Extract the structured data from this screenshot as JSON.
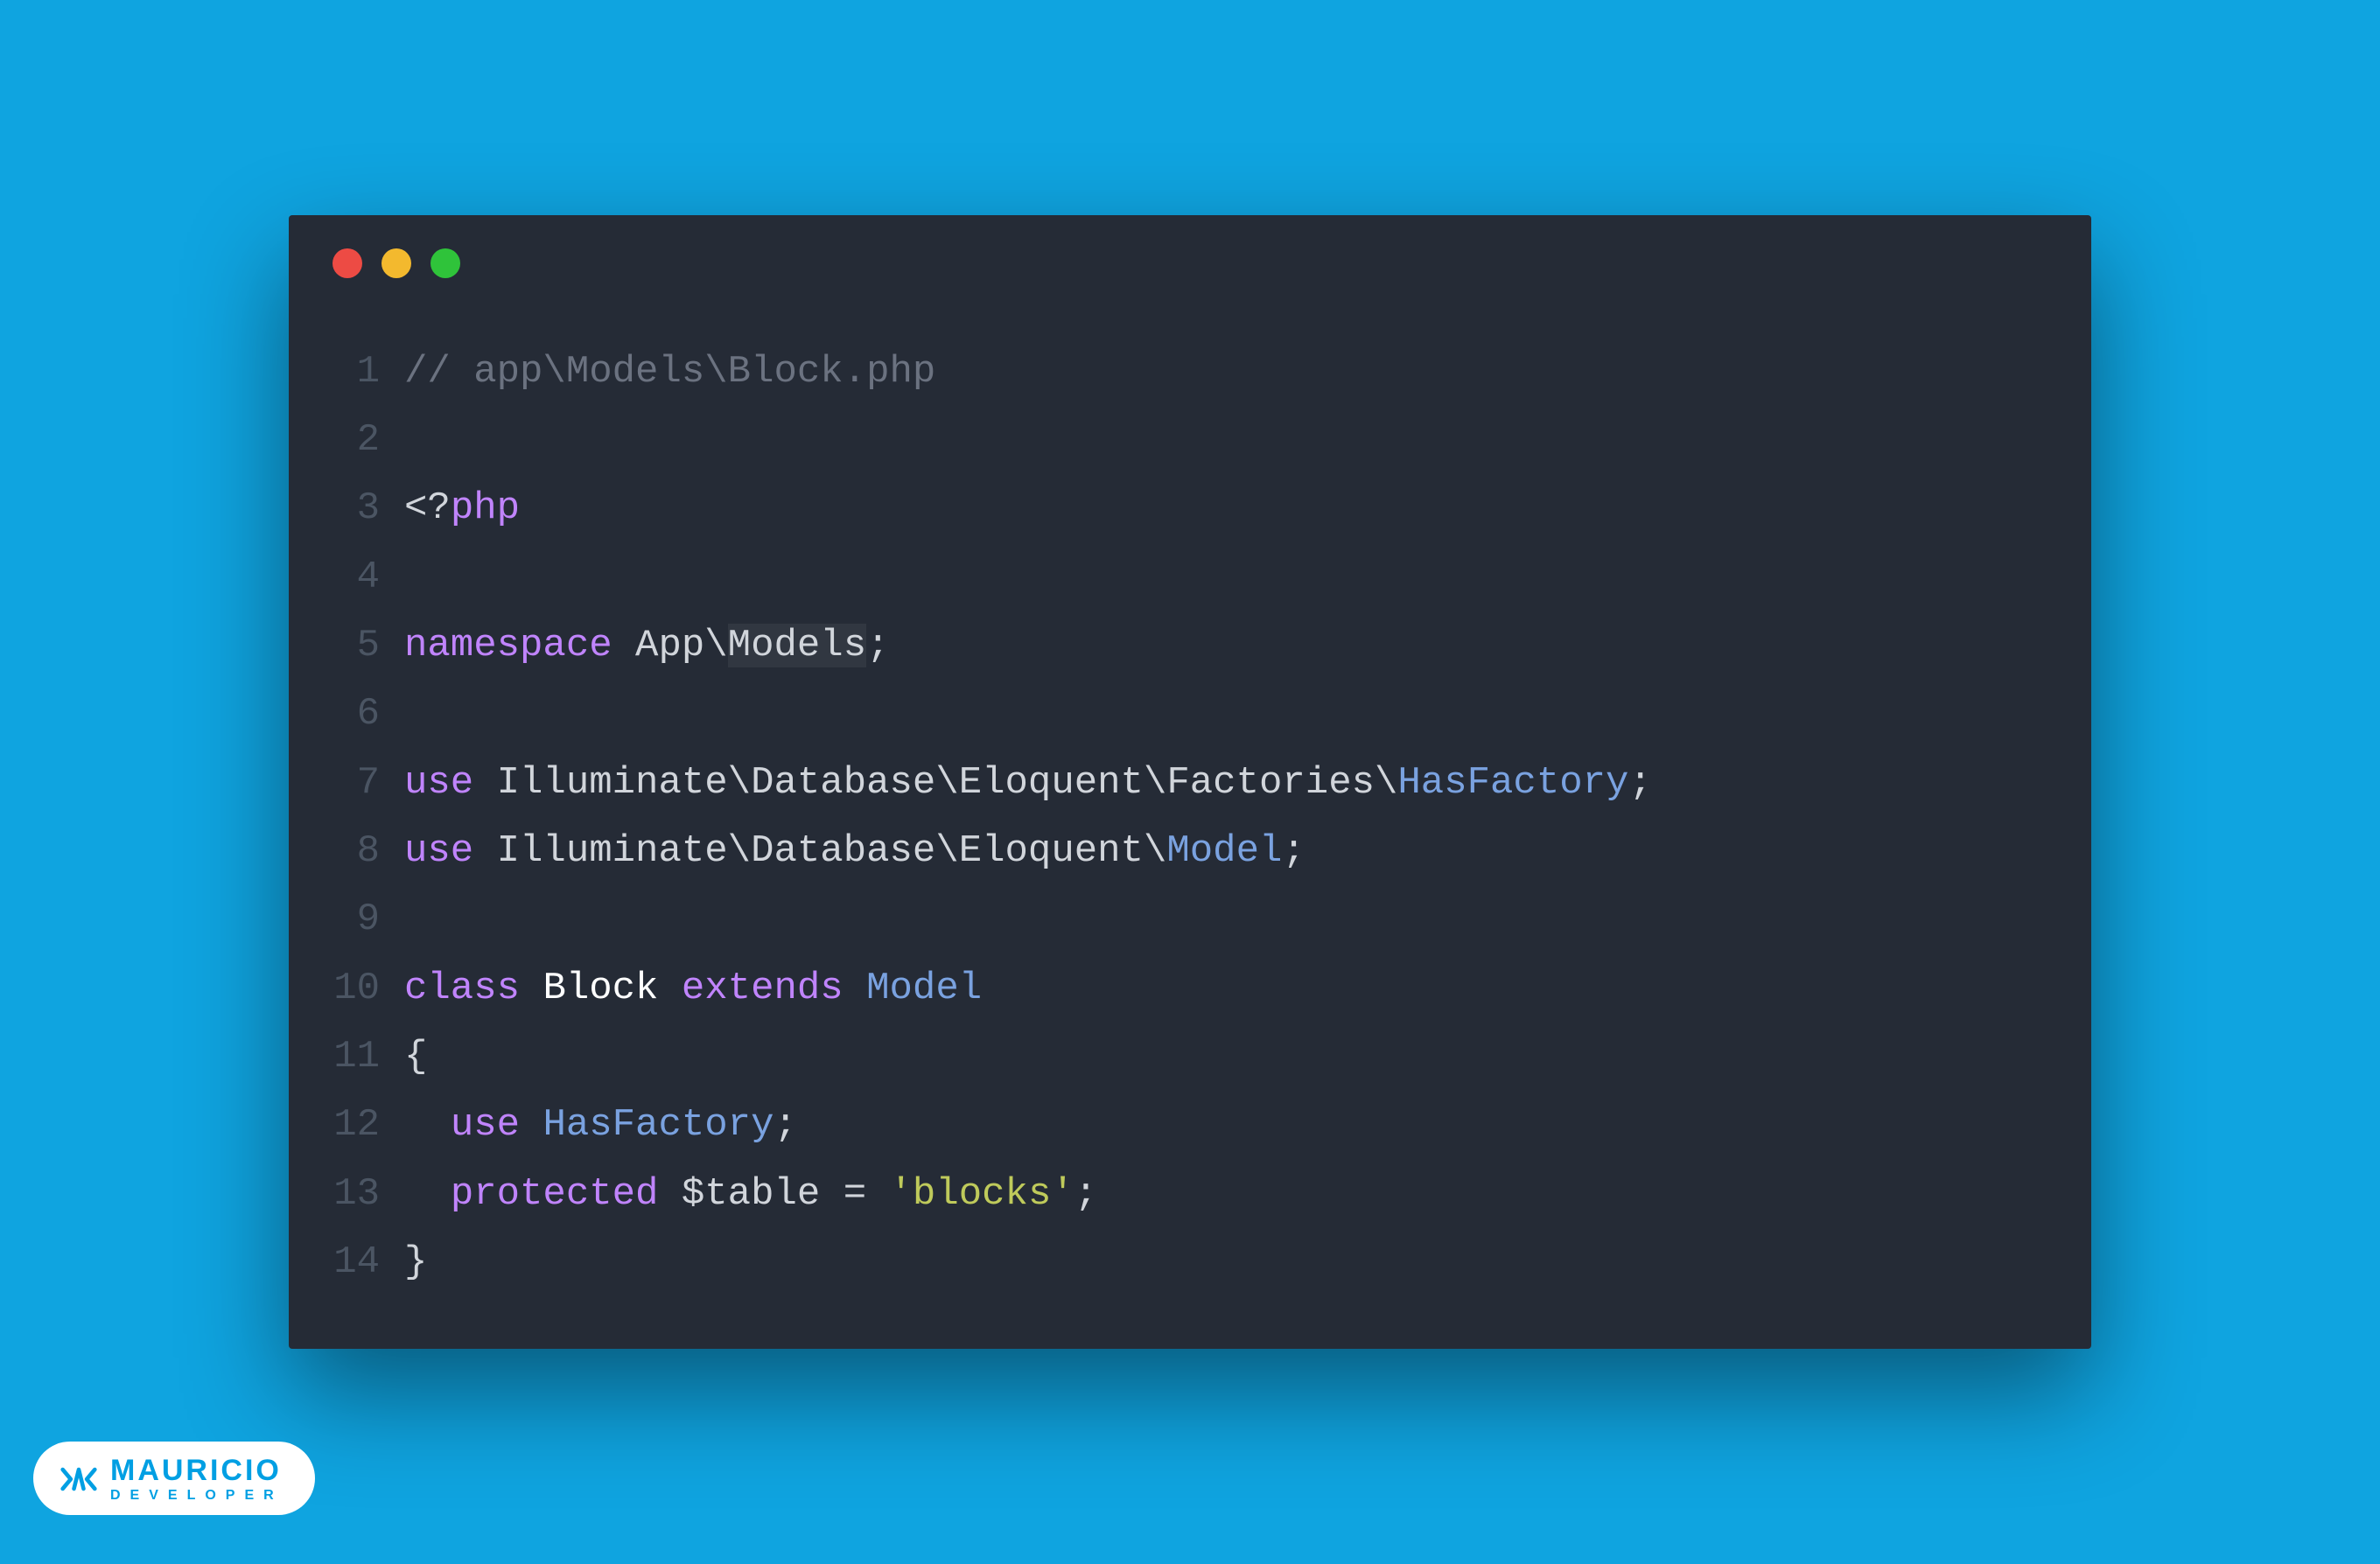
{
  "window": {
    "traffic_lights": {
      "red": "#ed4b44",
      "yellow": "#f3b92e",
      "green": "#2fc33a"
    }
  },
  "code": {
    "lines": [
      {
        "n": 1,
        "tokens": [
          {
            "t": "// app\\Models\\Block.php",
            "c": "c-comment"
          }
        ]
      },
      {
        "n": 2,
        "tokens": []
      },
      {
        "n": 3,
        "tokens": [
          {
            "t": "<?",
            "c": "c-default"
          },
          {
            "t": "php",
            "c": "c-keyword"
          }
        ]
      },
      {
        "n": 4,
        "tokens": []
      },
      {
        "n": 5,
        "tokens": [
          {
            "t": "namespace",
            "c": "c-keyword"
          },
          {
            "t": " ",
            "c": "c-default"
          },
          {
            "t": "App",
            "c": "c-default"
          },
          {
            "t": "\\",
            "c": "c-default"
          },
          {
            "t": "Models",
            "c": "c-default",
            "hl": true
          },
          {
            "t": ";",
            "c": "c-punc"
          }
        ]
      },
      {
        "n": 6,
        "tokens": []
      },
      {
        "n": 7,
        "tokens": [
          {
            "t": "use",
            "c": "c-keyword"
          },
          {
            "t": " ",
            "c": "c-default"
          },
          {
            "t": "Illuminate",
            "c": "c-default"
          },
          {
            "t": "\\",
            "c": "c-default"
          },
          {
            "t": "Database",
            "c": "c-default"
          },
          {
            "t": "\\",
            "c": "c-default"
          },
          {
            "t": "Eloquent",
            "c": "c-default"
          },
          {
            "t": "\\",
            "c": "c-default"
          },
          {
            "t": "Factories",
            "c": "c-default"
          },
          {
            "t": "\\",
            "c": "c-default"
          },
          {
            "t": "HasFactory",
            "c": "c-type"
          },
          {
            "t": ";",
            "c": "c-punc"
          }
        ]
      },
      {
        "n": 8,
        "tokens": [
          {
            "t": "use",
            "c": "c-keyword"
          },
          {
            "t": " ",
            "c": "c-default"
          },
          {
            "t": "Illuminate",
            "c": "c-default"
          },
          {
            "t": "\\",
            "c": "c-default"
          },
          {
            "t": "Database",
            "c": "c-default"
          },
          {
            "t": "\\",
            "c": "c-default"
          },
          {
            "t": "Eloquent",
            "c": "c-default"
          },
          {
            "t": "\\",
            "c": "c-default"
          },
          {
            "t": "Model",
            "c": "c-type"
          },
          {
            "t": ";",
            "c": "c-punc"
          }
        ]
      },
      {
        "n": 9,
        "tokens": []
      },
      {
        "n": 10,
        "tokens": [
          {
            "t": "class",
            "c": "c-keyword"
          },
          {
            "t": " ",
            "c": "c-default"
          },
          {
            "t": "Block",
            "c": "c-white"
          },
          {
            "t": " ",
            "c": "c-default"
          },
          {
            "t": "extends",
            "c": "c-keyword"
          },
          {
            "t": " ",
            "c": "c-default"
          },
          {
            "t": "Model",
            "c": "c-type"
          }
        ]
      },
      {
        "n": 11,
        "tokens": [
          {
            "t": "{",
            "c": "c-punc"
          }
        ]
      },
      {
        "n": 12,
        "tokens": [
          {
            "t": "  ",
            "c": "c-default"
          },
          {
            "t": "use",
            "c": "c-keyword"
          },
          {
            "t": " ",
            "c": "c-default"
          },
          {
            "t": "HasFactory",
            "c": "c-type"
          },
          {
            "t": ";",
            "c": "c-punc"
          }
        ]
      },
      {
        "n": 13,
        "tokens": [
          {
            "t": "  ",
            "c": "c-default"
          },
          {
            "t": "protected",
            "c": "c-keyword"
          },
          {
            "t": " ",
            "c": "c-default"
          },
          {
            "t": "$table",
            "c": "c-var"
          },
          {
            "t": " ",
            "c": "c-default"
          },
          {
            "t": "=",
            "c": "c-punc"
          },
          {
            "t": " ",
            "c": "c-default"
          },
          {
            "t": "'blocks'",
            "c": "c-string"
          },
          {
            "t": ";",
            "c": "c-punc"
          }
        ]
      },
      {
        "n": 14,
        "tokens": [
          {
            "t": "}",
            "c": "c-punc"
          }
        ]
      }
    ]
  },
  "badge": {
    "name": "MAURICIO",
    "subtitle": "DEVELOPER"
  }
}
